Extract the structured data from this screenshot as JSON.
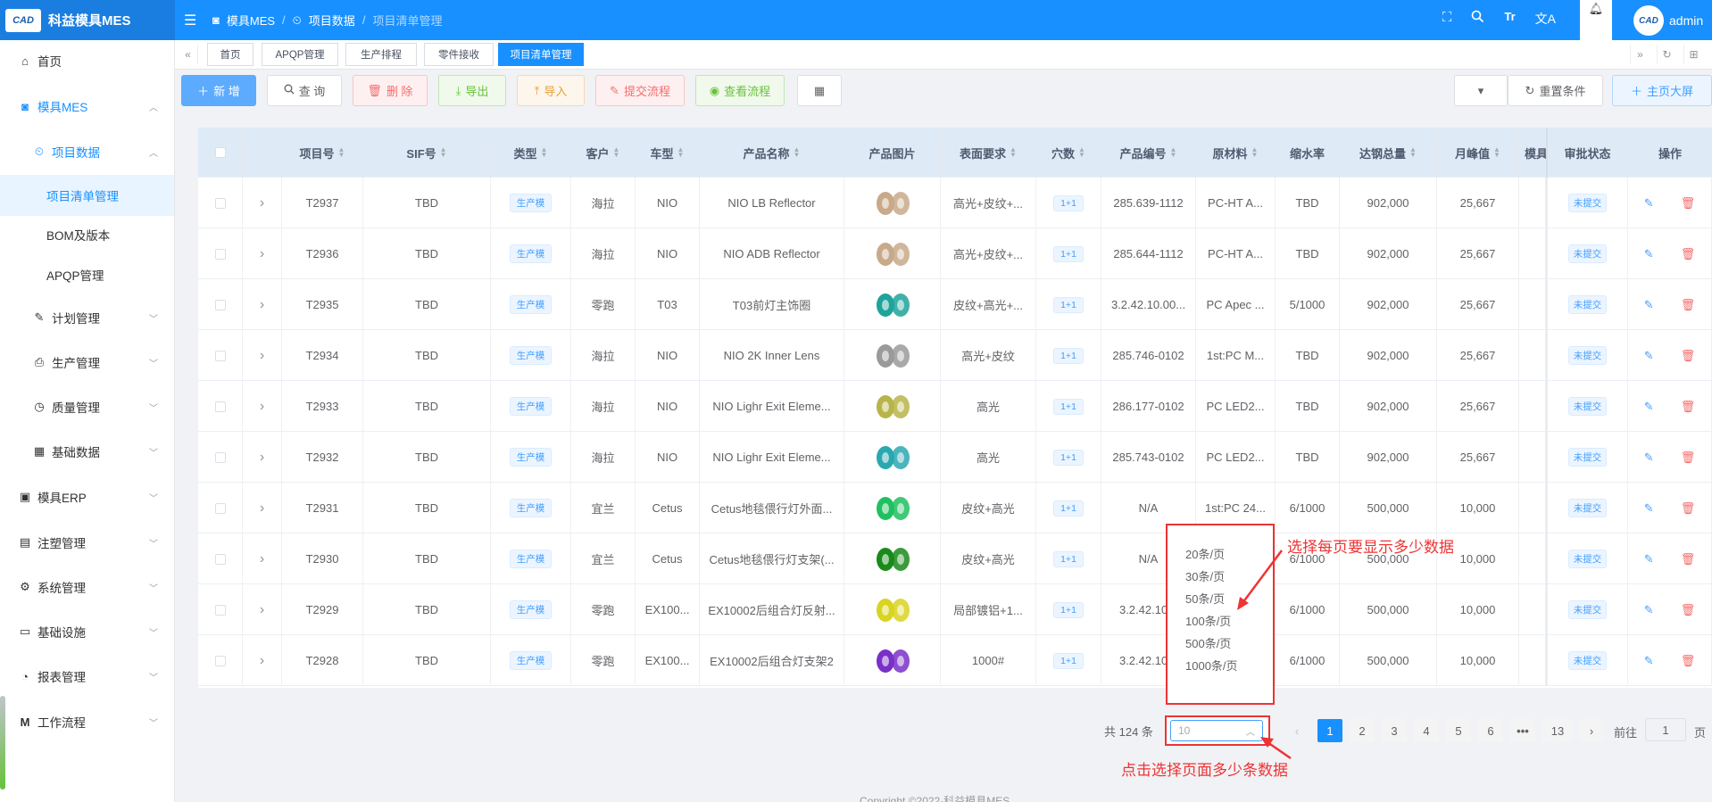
{
  "header": {
    "logo_text": "CAD",
    "app_title": "科益模具MES",
    "breadcrumb": [
      "模具MES",
      "项目数据",
      "项目清单管理"
    ],
    "user": "admin",
    "icons": [
      "fullscreen-icon",
      "search-icon",
      "font-size-icon",
      "translate-icon",
      "bell-icon"
    ]
  },
  "sidebar": {
    "items": [
      {
        "label": "首页",
        "icon": "home-icon"
      },
      {
        "label": "模具MES",
        "icon": "camera-icon"
      },
      {
        "label": "项目数据",
        "icon": "clock-icon"
      },
      {
        "label": "项目清单管理"
      },
      {
        "label": "BOM及版本"
      },
      {
        "label": "APQP管理"
      },
      {
        "label": "计划管理",
        "icon": "edit-icon"
      },
      {
        "label": "生产管理",
        "icon": "print-icon"
      },
      {
        "label": "质量管理",
        "icon": "timer-icon"
      },
      {
        "label": "基础数据",
        "icon": "calendar-icon"
      },
      {
        "label": "模具ERP",
        "icon": "box-icon"
      },
      {
        "label": "注塑管理",
        "icon": "mold-icon"
      },
      {
        "label": "系统管理",
        "icon": "gear-icon"
      },
      {
        "label": "基础设施",
        "icon": "monitor-icon"
      },
      {
        "label": "报表管理",
        "icon": "chart-icon"
      },
      {
        "label": "工作流程",
        "icon": "flow-icon"
      }
    ]
  },
  "tags": [
    "首页",
    "APQP管理",
    "生产排程",
    "零件接收",
    "项目清单管理"
  ],
  "toolbar": {
    "add": "新 增",
    "query": "查 询",
    "delete": "删 除",
    "export": "导出",
    "import": "导入",
    "submit": "提交流程",
    "view": "查看流程",
    "reset": "重置条件",
    "dashboard": "主页大屏"
  },
  "table": {
    "headers": [
      "项目号",
      "SIF号",
      "类型",
      "客户",
      "车型",
      "产品名称",
      "产品图片",
      "表面要求",
      "穴数",
      "产品编号",
      "原材料",
      "缩水率",
      "达钢总量",
      "月峰值",
      "模具",
      "审批状态",
      "操作"
    ],
    "rows": [
      {
        "no": "T2937",
        "sif": "TBD",
        "type": "生产模",
        "customer": "海拉",
        "car": "NIO",
        "name": "NIO LB Reflector",
        "surface": "高光+皮纹+...",
        "cavity": "1+1",
        "code": "285.639-1112",
        "material": "PC-HT A...",
        "shrink": "TBD",
        "total": "902,000",
        "peak": "25,667",
        "status": "未提交"
      },
      {
        "no": "T2936",
        "sif": "TBD",
        "type": "生产模",
        "customer": "海拉",
        "car": "NIO",
        "name": "NIO ADB Reflector",
        "surface": "高光+皮纹+...",
        "cavity": "1+1",
        "code": "285.644-1112",
        "material": "PC-HT A...",
        "shrink": "TBD",
        "total": "902,000",
        "peak": "25,667",
        "status": "未提交"
      },
      {
        "no": "T2935",
        "sif": "TBD",
        "type": "生产模",
        "customer": "零跑",
        "car": "T03",
        "name": "T03前灯主饰圈",
        "surface": "皮纹+高光+...",
        "cavity": "1+1",
        "code": "3.2.42.10.00...",
        "material": "PC Apec ...",
        "shrink": "5/1000",
        "total": "902,000",
        "peak": "25,667",
        "status": "未提交"
      },
      {
        "no": "T2934",
        "sif": "TBD",
        "type": "生产模",
        "customer": "海拉",
        "car": "NIO",
        "name": "NIO 2K Inner Lens",
        "surface": "高光+皮纹",
        "cavity": "1+1",
        "code": "285.746-0102",
        "material": "1st:PC M...",
        "shrink": "TBD",
        "total": "902,000",
        "peak": "25,667",
        "status": "未提交"
      },
      {
        "no": "T2933",
        "sif": "TBD",
        "type": "生产模",
        "customer": "海拉",
        "car": "NIO",
        "name": "NIO Lighr Exit Eleme...",
        "surface": "高光",
        "cavity": "1+1",
        "code": "286.177-0102",
        "material": "PC LED2...",
        "shrink": "TBD",
        "total": "902,000",
        "peak": "25,667",
        "status": "未提交"
      },
      {
        "no": "T2932",
        "sif": "TBD",
        "type": "生产模",
        "customer": "海拉",
        "car": "NIO",
        "name": "NIO Lighr Exit Eleme...",
        "surface": "高光",
        "cavity": "1+1",
        "code": "285.743-0102",
        "material": "PC LED2...",
        "shrink": "TBD",
        "total": "902,000",
        "peak": "25,667",
        "status": "未提交"
      },
      {
        "no": "T2931",
        "sif": "TBD",
        "type": "生产模",
        "customer": "宜兰",
        "car": "Cetus",
        "name": "Cetus地毯偎行灯外面...",
        "surface": "皮纹+高光",
        "cavity": "1+1",
        "code": "N/A",
        "material": "1st:PC 24...",
        "shrink": "6/1000",
        "total": "500,000",
        "peak": "10,000",
        "status": "未提交"
      },
      {
        "no": "T2930",
        "sif": "TBD",
        "type": "生产模",
        "customer": "宜兰",
        "car": "Cetus",
        "name": "Cetus地毯偎行灯支架(...",
        "surface": "皮纹+高光",
        "cavity": "1+1",
        "code": "N/A",
        "material": "",
        "shrink": "6/1000",
        "total": "500,000",
        "peak": "10,000",
        "status": "未提交"
      },
      {
        "no": "T2929",
        "sif": "TBD",
        "type": "生产模",
        "customer": "零跑",
        "car": "EX100...",
        "name": "EX10002后组合灯反射...",
        "surface": "局部镀铝+1...",
        "cavity": "1+1",
        "code": "3.2.42.10.0",
        "material": "",
        "shrink": "6/1000",
        "total": "500,000",
        "peak": "10,000",
        "status": "未提交"
      },
      {
        "no": "T2928",
        "sif": "TBD",
        "type": "生产模",
        "customer": "零跑",
        "car": "EX100...",
        "name": "EX10002后组合灯支架2",
        "surface": "1000#",
        "cavity": "1+1",
        "code": "3.2.42.10.0",
        "material": "",
        "shrink": "6/1000",
        "total": "500,000",
        "peak": "10,000",
        "status": "未提交"
      }
    ]
  },
  "pagination": {
    "total": "共 124 条",
    "page_size": "10",
    "pages": [
      "1",
      "2",
      "3",
      "4",
      "5",
      "6",
      "•••",
      "13"
    ],
    "goto_label": "前往",
    "goto_value": "1",
    "page_suffix": "页",
    "options": [
      "20条/页",
      "30条/页",
      "50条/页",
      "100条/页",
      "500条/页",
      "1000条/页"
    ]
  },
  "annotations": {
    "top": "选择每页要显示多少数据",
    "bottom": "点击选择页面多少条数据"
  },
  "footer": "Copyright ©2022-科益模具MES",
  "colors": {
    "primary": "#1890ff",
    "annotation": "#ee3333"
  }
}
